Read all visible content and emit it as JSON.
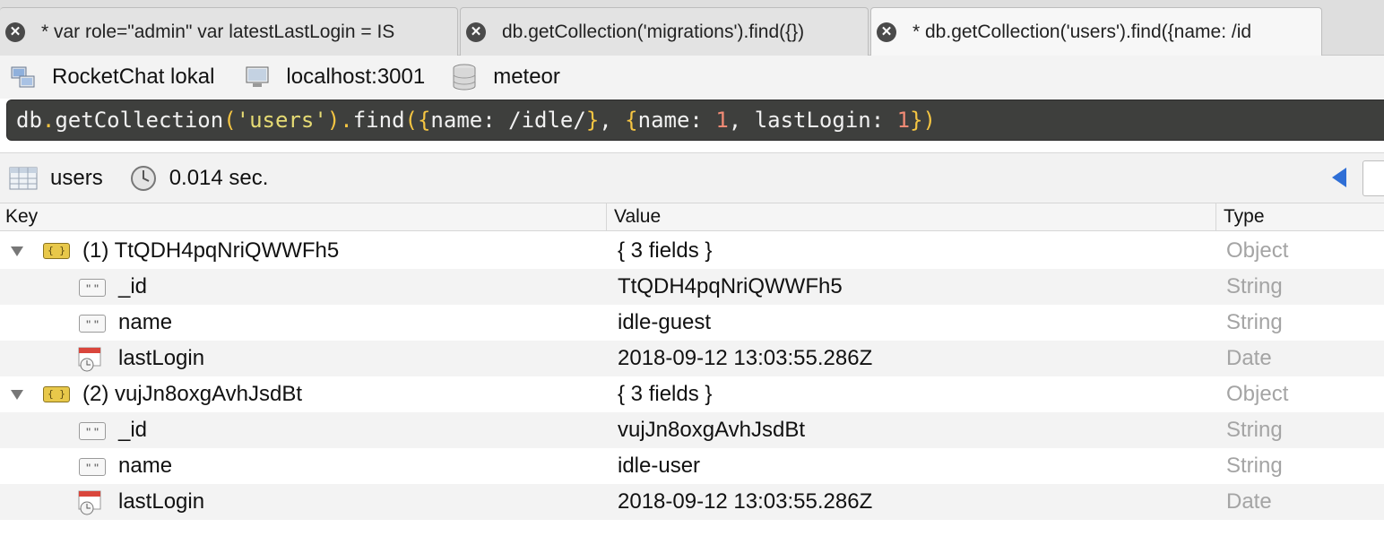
{
  "tabs": [
    {
      "label": "* var role=\"admin\" var latestLastLogin = IS",
      "active": false
    },
    {
      "label": "db.getCollection('migrations').find({})",
      "active": false
    },
    {
      "label": "* db.getCollection('users').find({name: /id",
      "active": true
    }
  ],
  "connection": {
    "name": "RocketChat lokal",
    "host": "localhost:3001",
    "database": "meteor"
  },
  "query": {
    "text": "db.getCollection('users').find({name: /idle/}, {name: 1, lastLogin: 1})",
    "tokens": {
      "db": "db",
      "dot1": ".",
      "method1": "getCollection",
      "paren1": "(",
      "collection": "'users'",
      "paren2": ")",
      "dot2": ".",
      "method2": "find",
      "paren3": "(",
      "brace1": "{",
      "key1": "name: /idle/",
      "brace2": "}",
      "comma1": ", ",
      "brace3": "{",
      "key2": "name: ",
      "num1": "1",
      "comma2": ", ",
      "key3": "lastLogin: ",
      "num2": "1",
      "brace4": "}",
      "paren4": ")"
    }
  },
  "result": {
    "collection": "users",
    "time": "0.014 sec."
  },
  "table": {
    "headers": {
      "key": "Key",
      "value": "Value",
      "type": "Type"
    },
    "rows": [
      {
        "kind": "object",
        "key": "(1) TtQDH4pqNriQWWFh5",
        "value": "{ 3 fields }",
        "type": "Object"
      },
      {
        "kind": "string",
        "key": "_id",
        "value": "TtQDH4pqNriQWWFh5",
        "type": "String"
      },
      {
        "kind": "string",
        "key": "name",
        "value": "idle-guest",
        "type": "String"
      },
      {
        "kind": "date",
        "key": "lastLogin",
        "value": "2018-09-12 13:03:55.286Z",
        "type": "Date"
      },
      {
        "kind": "object",
        "key": "(2) vujJn8oxgAvhJsdBt",
        "value": "{ 3 fields }",
        "type": "Object"
      },
      {
        "kind": "string",
        "key": "_id",
        "value": "vujJn8oxgAvhJsdBt",
        "type": "String"
      },
      {
        "kind": "string",
        "key": "name",
        "value": "idle-user",
        "type": "String"
      },
      {
        "kind": "date",
        "key": "lastLogin",
        "value": "2018-09-12 13:03:55.286Z",
        "type": "Date"
      }
    ]
  },
  "icons": {
    "tab_close": "close-circle-icon",
    "server": "server-icon",
    "host": "computer-icon",
    "database": "database-icon",
    "collection": "table-grid-icon",
    "timer": "clock-icon",
    "object": "object-braces-icon",
    "string": "string-quotes-icon",
    "date": "calendar-clock-icon"
  },
  "colors": {
    "editor_bg": "#3e3f3d",
    "string_token": "#e6db74",
    "number_token": "#f08a75",
    "punctuation_token": "#f5c542",
    "type_text": "#a4a4a4",
    "nav_arrow": "#2f6fd6"
  }
}
